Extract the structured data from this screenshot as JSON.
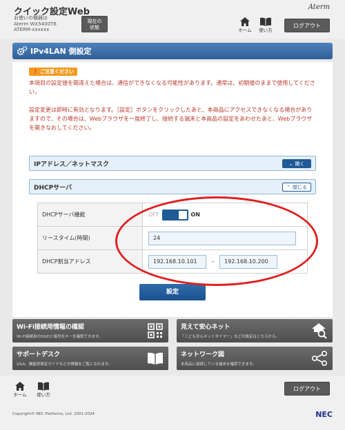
{
  "header": {
    "app_title": "クイック設定Web",
    "device_line1": "お使いの機器は",
    "device_line2": "Aterm WX5400T6",
    "device_line3": "ATERM-xxxxxx",
    "status_label_line1": "現在の",
    "status_label_line2": "状態",
    "brand": "Aterm",
    "nav_home": "ホーム",
    "nav_help": "使い方",
    "logout": "ログアウト"
  },
  "page": {
    "title": "IPv4LAN 側設定"
  },
  "notice": {
    "badge": "ご注意ください",
    "para1": "本項目の設定値を間違えた場合は、通信ができなくなる可能性があります。通常は、初期値のままで使用してください。",
    "para2": "設定変更は即時に有効となります。［設定］ボタンをクリックしたあと、本商品にアクセスできなくなる場合がありますので、その場合は、Webブラウザを一度終了し、接続する端末と本商品の設定をあわせたあと、Webブラウザを開きなおしてください。"
  },
  "sections": {
    "ip_mask": {
      "label": "IPアドレス／ネットマスク",
      "toggle": "開く"
    },
    "dhcp": {
      "label": "DHCPサーバ",
      "toggle": "閉じる"
    }
  },
  "dhcp_settings": {
    "server_label": "DHCPサーバ機能",
    "switch_off": "OFF",
    "switch_on": "ON",
    "lease_label": "リースタイム(時間)",
    "lease_value": "24",
    "range_label": "DHCP割当アドレス",
    "range_start": "192.168.10.101",
    "range_sep": "-",
    "range_end": "192.168.10.200"
  },
  "submit": "設定",
  "cards": {
    "wifi": {
      "title": "Wi-Fi接続用情報の確認",
      "desc": "Wi-Fi接続用のSSIDと暗号化キーを確認できます。"
    },
    "safe": {
      "title": "見えて安心ネット",
      "desc": "「こども安心ネットタイマー」などの設定はこちらから。"
    },
    "support": {
      "title": "サポートデスク",
      "desc": "Q&A、機能別設定ガイドなどの情報をご覧になれます。"
    },
    "network": {
      "title": "ネットワーク図",
      "desc": "本商品に接続している端末を確認できます。"
    }
  },
  "footer": {
    "nav_home": "ホーム",
    "nav_help": "使い方",
    "logout": "ログアウト",
    "copyright": "Copyright© NEC Platforms, Ltd. 2001-2024",
    "brand": "NEC"
  },
  "colors": {
    "accent": "#1f5a96",
    "title_bar": "#3a6ea5",
    "notice_text": "#b8392d",
    "notice_badge": "#f39a1e",
    "highlight_ellipse": "#e02020"
  }
}
